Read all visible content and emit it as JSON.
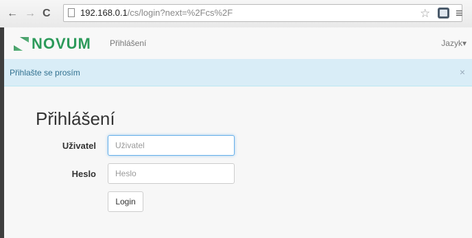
{
  "browser": {
    "back_glyph": "←",
    "forward_glyph": "→",
    "reload_glyph": "C",
    "url_host": "192.168.0.1",
    "url_path": "/cs/login?next=%2Fcs%2F",
    "star_glyph": "☆",
    "menu_glyph": "≡"
  },
  "navbar": {
    "brand": "NOVUM",
    "link_login": "Přihlášení",
    "language": "Jazyk",
    "language_caret": "▾"
  },
  "alert": {
    "message": "Přihlašte se prosím",
    "close_glyph": "×",
    "color": "#d9edf7"
  },
  "form": {
    "title": "Přihlášení",
    "username_label": "Uživatel",
    "username_placeholder": "Uživatel",
    "password_label": "Heslo",
    "password_placeholder": "Heslo",
    "submit_label": "Login"
  },
  "colors": {
    "brand_green": "#2c9a5a",
    "focus_blue": "#66afe9"
  }
}
